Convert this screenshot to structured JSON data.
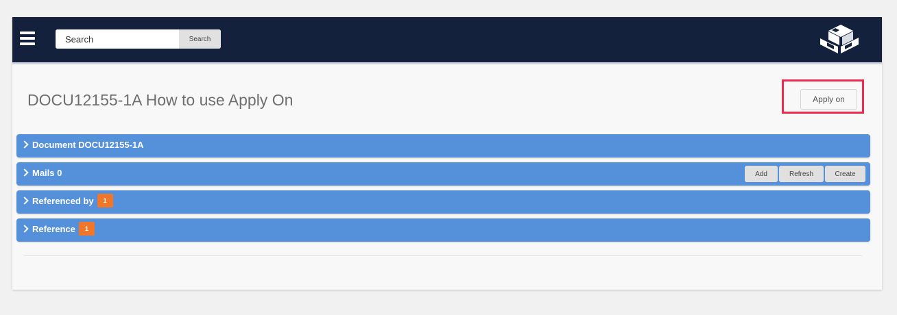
{
  "header": {
    "search": {
      "placeholder": "Search",
      "value": "",
      "button_label": "Search"
    },
    "menu_icon": "hamburger-menu-icon",
    "logo": "company-logo"
  },
  "document": {
    "title": "DOCU12155-1A How to use Apply On",
    "apply_on_label": "Apply on",
    "highlight_color": "#ed2b4e"
  },
  "panels": [
    {
      "label": "Document DOCU12155-1A"
    },
    {
      "label": "Mails 0",
      "actions": {
        "add": "Add",
        "refresh": "Refresh",
        "create": "Create"
      }
    },
    {
      "label": "Referenced by",
      "badge": "1"
    },
    {
      "label": "Reference",
      "badge": "1"
    }
  ],
  "colors": {
    "header_bg": "#14213d",
    "panel_bg": "#5590da",
    "badge_bg": "#f0772a"
  }
}
